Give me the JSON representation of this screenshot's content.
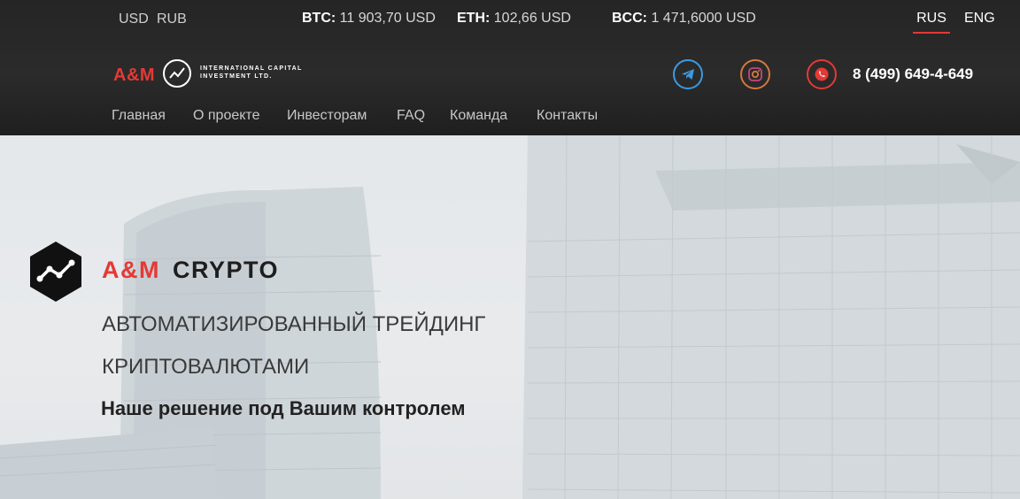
{
  "currencies": [
    "USD",
    "RUB"
  ],
  "rates": [
    {
      "symbol": "BTC:",
      "value": "11 903,70 USD"
    },
    {
      "symbol": "ETH:",
      "value": "102,66 USD"
    },
    {
      "symbol": "BCC:",
      "value": "1 471,6000 USD"
    }
  ],
  "languages": [
    {
      "label": "RUS",
      "active": true
    },
    {
      "label": "ENG",
      "active": false
    }
  ],
  "logo": {
    "name": "A&M",
    "subtitle_line1": "INTERNATIONAL CAPITAL",
    "subtitle_line2": "INVESTMENT LTD."
  },
  "social": [
    {
      "name": "telegram-icon",
      "color": "#3b9ae0"
    },
    {
      "name": "instagram-icon",
      "color": "#d4783c"
    },
    {
      "name": "phone-icon",
      "color": "#e53935"
    }
  ],
  "phone": "8 (499) 649-4-649",
  "nav": [
    "Главная",
    "О проекте",
    "Инвесторам",
    "FAQ",
    "Команда",
    "Контакты"
  ],
  "hero": {
    "brand_red": "A&M",
    "brand_dark": "CRYPTO",
    "line1": "АВТОМАТИЗИРОВАННЫЙ ТРЕЙДИНГ",
    "line2": "КРИПТОВАЛЮТАМИ",
    "tagline": "Наше решение под Вашим контролем"
  },
  "colors": {
    "accent": "#e53935",
    "header_bg": "#2a2a2a"
  }
}
